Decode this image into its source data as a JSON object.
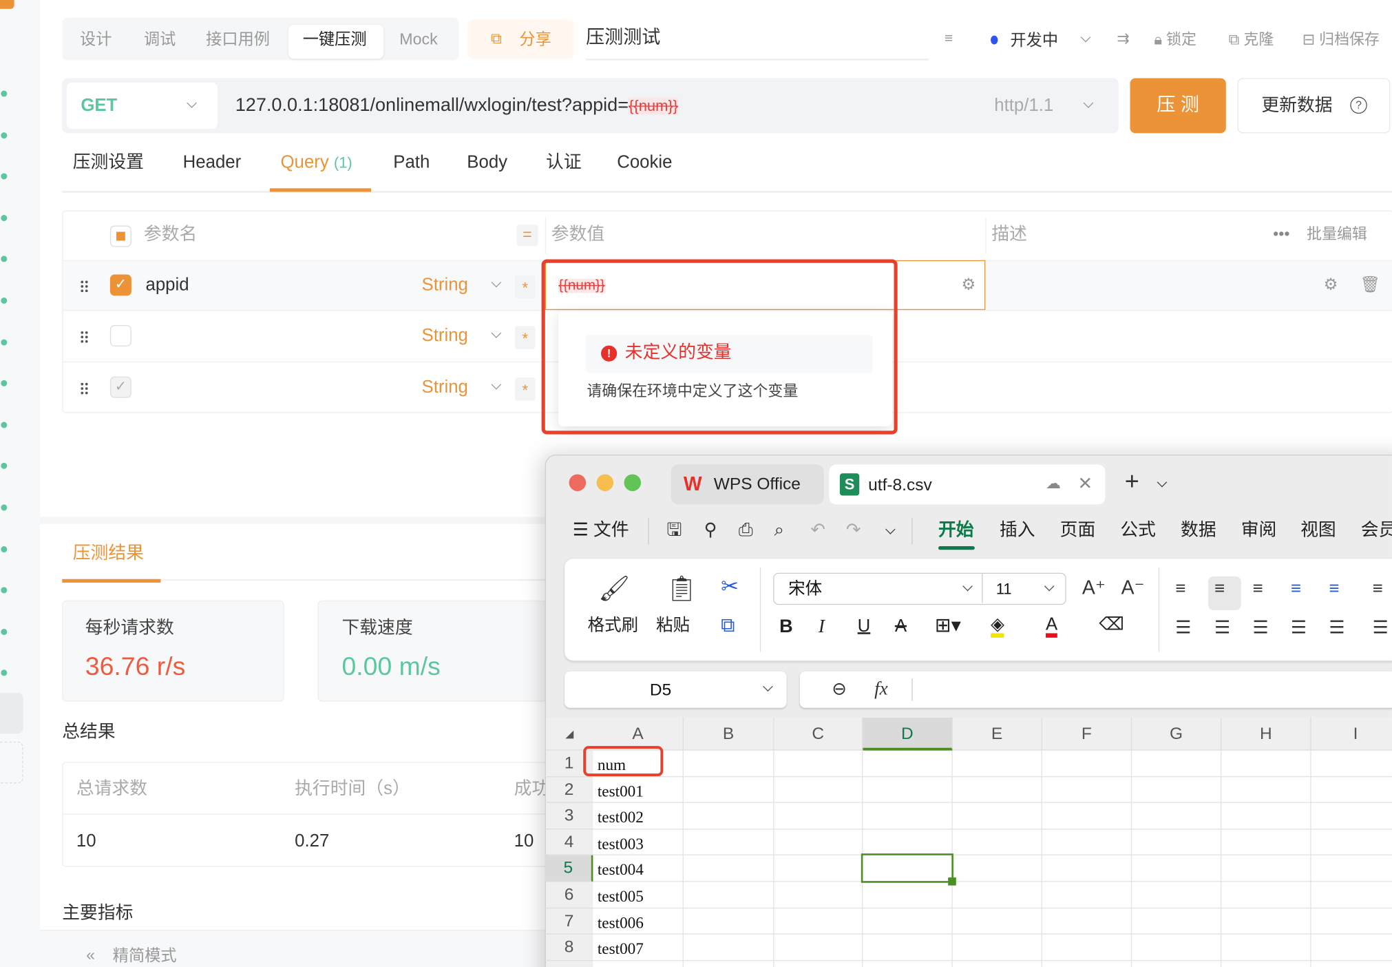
{
  "top_tabs": {
    "items": [
      "设计",
      "调试",
      "接口用例",
      "一键压测",
      "Mock"
    ],
    "active": "一键压测"
  },
  "share_label": "分享",
  "api_title": "压测测试",
  "status": {
    "label": "开发中",
    "color": "#2f54eb"
  },
  "actions": {
    "lock": "锁定",
    "clone": "克隆",
    "archive": "归档保存"
  },
  "request": {
    "method": "GET",
    "url": "127.0.0.1:18081/onlinemall/wxlogin/test?appid=",
    "url_var": "{{num}}",
    "protocol": "http/1.1",
    "run_label": "压 测",
    "update_label": "更新数据"
  },
  "sub_tabs": {
    "items": [
      "压测设置",
      "Header",
      "Query",
      "Path",
      "Body",
      "认证",
      "Cookie"
    ],
    "query_count": "(1)",
    "active": "Query"
  },
  "params": {
    "headers": {
      "name": "参数名",
      "value": "参数值",
      "desc": "描述",
      "bulk": "批量编辑"
    },
    "rows": [
      {
        "name": "appid",
        "type": "String",
        "required": "*",
        "value": "{{num}}",
        "checked": true
      },
      {
        "name": "",
        "type": "String",
        "required": "*",
        "value": "",
        "checked": false
      },
      {
        "name": "",
        "type": "String",
        "required": "*",
        "value": "",
        "checked": "disabled"
      }
    ]
  },
  "tooltip": {
    "title": "未定义的变量",
    "message": "请确保在环境中定义了这个变量"
  },
  "results": {
    "tab": "压测结果",
    "cards": [
      {
        "label": "每秒请求数",
        "value": "36.76 r/s",
        "color": "#ef5b3f"
      },
      {
        "label": "下载速度",
        "value": "0.00 m/s",
        "color": "#5cc79e"
      }
    ],
    "summary_title": "总结果",
    "summary_headers": [
      "总请求数",
      "执行时间（s）",
      "成功"
    ],
    "summary_values": [
      "10",
      "0.27",
      "10"
    ],
    "metrics_title": "主要指标",
    "compact_mode": "精简模式"
  },
  "wps": {
    "tabs": [
      {
        "label": "WPS Office"
      },
      {
        "label": "utf-8.csv"
      }
    ],
    "menu": {
      "file": "文件",
      "items": [
        "开始",
        "插入",
        "页面",
        "公式",
        "数据",
        "审阅",
        "视图",
        "会员"
      ],
      "active": "开始"
    },
    "ribbon": {
      "format_painter": "格式刷",
      "paste": "粘贴",
      "font": "宋体",
      "size": "11"
    },
    "name_box": "D5",
    "fx": "fx",
    "columns": [
      "A",
      "B",
      "C",
      "D",
      "E",
      "F",
      "G",
      "H",
      "I"
    ],
    "rows": [
      "1",
      "2",
      "3",
      "4",
      "5",
      "6",
      "7",
      "8"
    ],
    "cells_a": [
      "num",
      "test001",
      "test002",
      "test003",
      "test004",
      "test005",
      "test006",
      "test007"
    ],
    "selected_cell": "D5",
    "accent": "#0e7a4b"
  }
}
